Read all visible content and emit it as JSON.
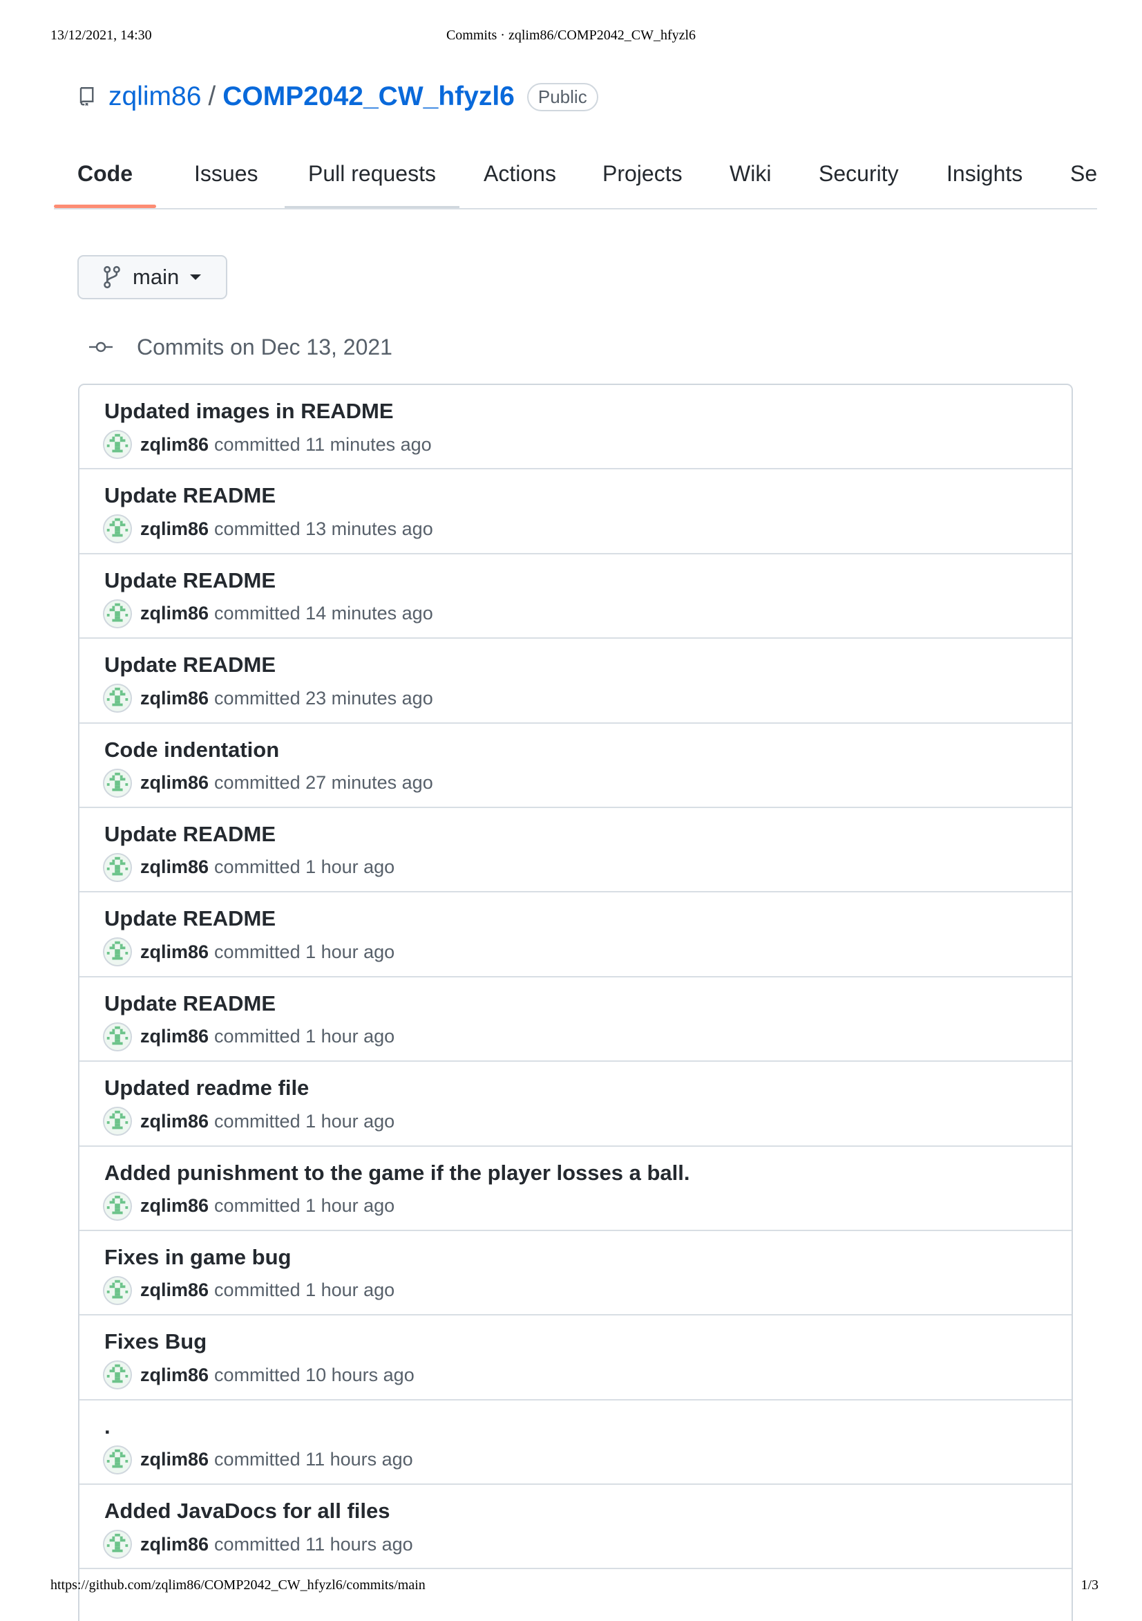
{
  "print_header": {
    "datetime": "13/12/2021, 14:30",
    "page_title": "Commits · zqlim86/COMP2042_CW_hfyzl6"
  },
  "print_footer": {
    "url": "https://github.com/zqlim86/COMP2042_CW_hfyzl6/commits/main",
    "page_number": "1/3"
  },
  "repo": {
    "owner": "zqlim86",
    "separator": "/",
    "name": "COMP2042_CW_hfyzl6",
    "visibility": "Public"
  },
  "tabs": [
    "Code",
    "Issues",
    "Pull requests",
    "Actions",
    "Projects",
    "Wiki",
    "Security",
    "Insights",
    "Settings"
  ],
  "active_tab": "Code",
  "branch": {
    "name": "main"
  },
  "commits_date_label": "Commits on Dec 13, 2021",
  "commits": [
    {
      "title": "Updated images in README",
      "author": "zqlim86",
      "meta": "committed 11 minutes ago"
    },
    {
      "title": "Update README",
      "author": "zqlim86",
      "meta": "committed 13 minutes ago"
    },
    {
      "title": "Update README",
      "author": "zqlim86",
      "meta": "committed 14 minutes ago"
    },
    {
      "title": "Update README",
      "author": "zqlim86",
      "meta": "committed 23 minutes ago"
    },
    {
      "title": "Code indentation",
      "author": "zqlim86",
      "meta": "committed 27 minutes ago"
    },
    {
      "title": "Update README",
      "author": "zqlim86",
      "meta": "committed 1 hour ago"
    },
    {
      "title": "Update README",
      "author": "zqlim86",
      "meta": "committed 1 hour ago"
    },
    {
      "title": "Update README",
      "author": "zqlim86",
      "meta": "committed 1 hour ago"
    },
    {
      "title": "Updated readme file",
      "author": "zqlim86",
      "meta": "committed 1 hour ago"
    },
    {
      "title": "Added punishment to the game if the player losses a ball.",
      "author": "zqlim86",
      "meta": "committed 1 hour ago"
    },
    {
      "title": "Fixes in game bug",
      "author": "zqlim86",
      "meta": "committed 1 hour ago"
    },
    {
      "title": "Fixes Bug",
      "author": "zqlim86",
      "meta": "committed 10 hours ago"
    },
    {
      "title": ".",
      "author": "zqlim86",
      "meta": "committed 11 hours ago"
    },
    {
      "title": "Added JavaDocs for all files",
      "author": "zqlim86",
      "meta": "committed 11 hours ago"
    }
  ],
  "colors": {
    "link": "#0969da",
    "active_tab_underline": "#fd8c73",
    "avatar_green": "#6cc38a"
  }
}
